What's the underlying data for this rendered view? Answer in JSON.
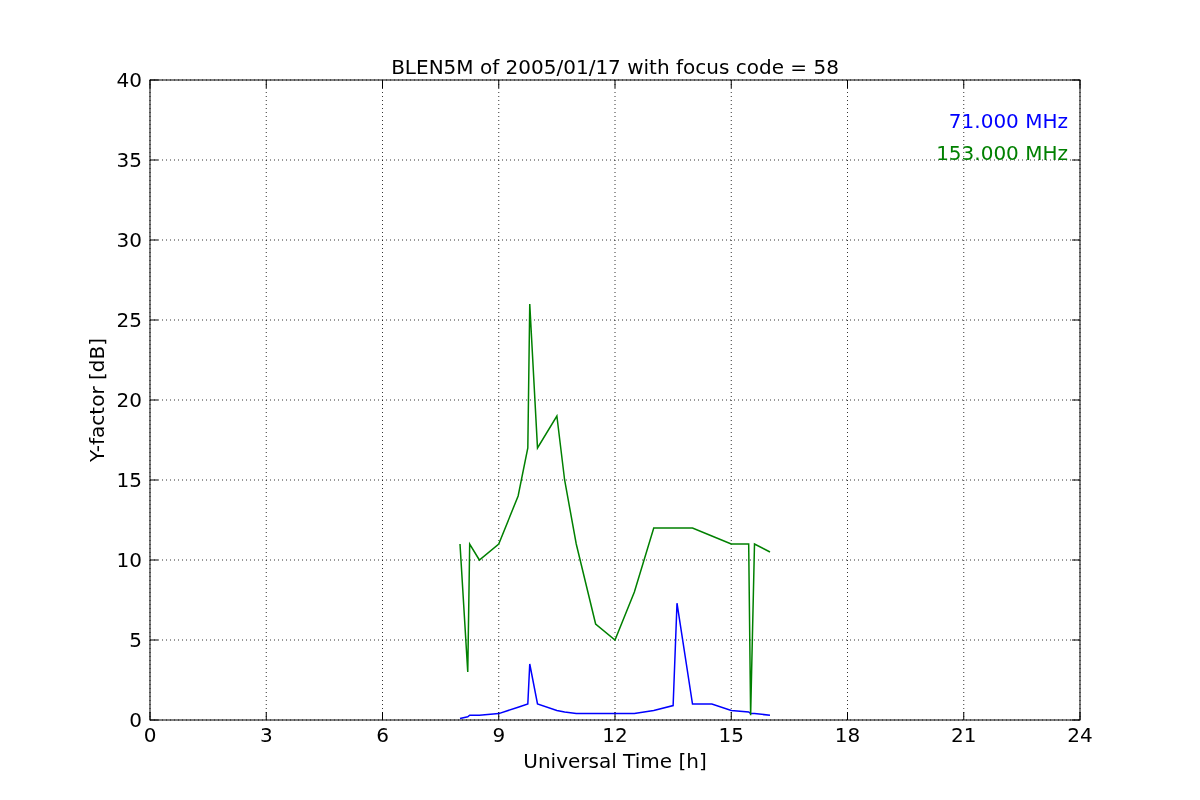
{
  "chart_data": {
    "type": "line",
    "title": "BLEN5M of 2005/01/17 with focus code = 58",
    "xlabel": "Universal Time [h]",
    "ylabel": "Y-factor [dB]",
    "x": [
      8,
      8.2,
      8.25,
      8.5,
      9,
      9.5,
      9.75,
      9.8,
      10,
      10.5,
      10.7,
      11,
      11.5,
      12,
      12.5,
      13,
      13.5,
      13.6,
      14,
      14.5,
      15,
      15.45,
      15.5,
      15.6,
      16
    ],
    "series": [
      {
        "name": "71.000 MHz",
        "color": "#0000ff",
        "values": [
          0.1,
          0.2,
          0.3,
          0.3,
          0.4,
          0.8,
          1,
          3.5,
          1,
          0.6,
          0.5,
          0.4,
          0.4,
          0.4,
          0.4,
          0.6,
          0.9,
          7.3,
          1,
          1,
          0.6,
          0.5,
          0.4,
          0.4,
          0.3
        ]
      },
      {
        "name": "153.000 MHz",
        "color": "#008000",
        "values": [
          11,
          3,
          11,
          10,
          11,
          14,
          17,
          26,
          17,
          19,
          15,
          11,
          6,
          5,
          8,
          12,
          12,
          12,
          12,
          11.5,
          11,
          11,
          0.3,
          11,
          10.5
        ]
      }
    ],
    "grid": true,
    "xlim": [
      0,
      24
    ],
    "ylim": [
      0,
      40
    ],
    "xticks": [
      0,
      3,
      6,
      9,
      12,
      15,
      18,
      21,
      24
    ],
    "yticks": [
      0,
      5,
      10,
      15,
      20,
      25,
      30,
      35,
      40
    ]
  }
}
